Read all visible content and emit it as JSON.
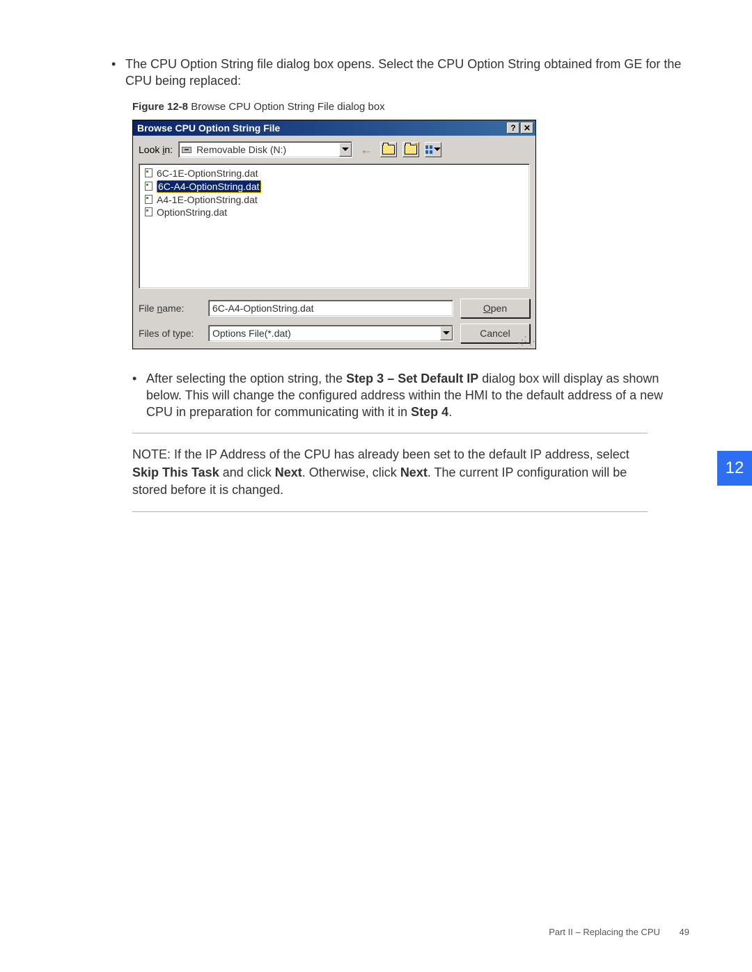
{
  "body": {
    "bullet1": "The CPU Option String file dialog box opens. Select the CPU Option String obtained from GE for the CPU being replaced:",
    "figcap_bold": "Figure 12-8",
    "figcap_rest": "  Browse CPU Option String File dialog box",
    "bullet2_pre": "After selecting the option string, the ",
    "bullet2_bold1": "Step 3 – Set Default IP",
    "bullet2_mid": " dialog box will display as shown below. This will change the configured address within the HMI to the default address of a new CPU in preparation for communicating with it in ",
    "bullet2_bold2": "Step 4",
    "bullet2_end": "."
  },
  "note": {
    "lead": "NOTE:    ",
    "t1": "If the IP Address of the CPU has already been set to the default IP address, select ",
    "b1": "Skip This Task",
    "t2": " and click ",
    "b2": "Next",
    "t3": ". Otherwise, click ",
    "b3": "Next",
    "t4": ". The current IP configuration will be stored before it is changed."
  },
  "dialog": {
    "title": "Browse CPU Option String File",
    "lookin_label_pre": "Look ",
    "lookin_label_u": "i",
    "lookin_label_post": "n:",
    "lookin_value": "Removable Disk (N:)",
    "files": [
      {
        "name": "6C-1E-OptionString.dat",
        "selected": false
      },
      {
        "name": "6C-A4-OptionString.dat",
        "selected": true
      },
      {
        "name": "A4-1E-OptionString.dat",
        "selected": false
      },
      {
        "name": "OptionString.dat",
        "selected": false
      }
    ],
    "filename_label_pre": "File ",
    "filename_label_u": "n",
    "filename_label_post": "ame:",
    "filename_value": "6C-A4-OptionString.dat",
    "filetype_label": "Files of type:",
    "filetype_value": "Options File(*.dat)",
    "open_u": "O",
    "open_rest": "pen",
    "cancel": "Cancel",
    "help_btn": "?",
    "close_btn": "✕"
  },
  "sidetab": "12",
  "footer": {
    "text": "Part II – Replacing the CPU",
    "page": "49"
  }
}
